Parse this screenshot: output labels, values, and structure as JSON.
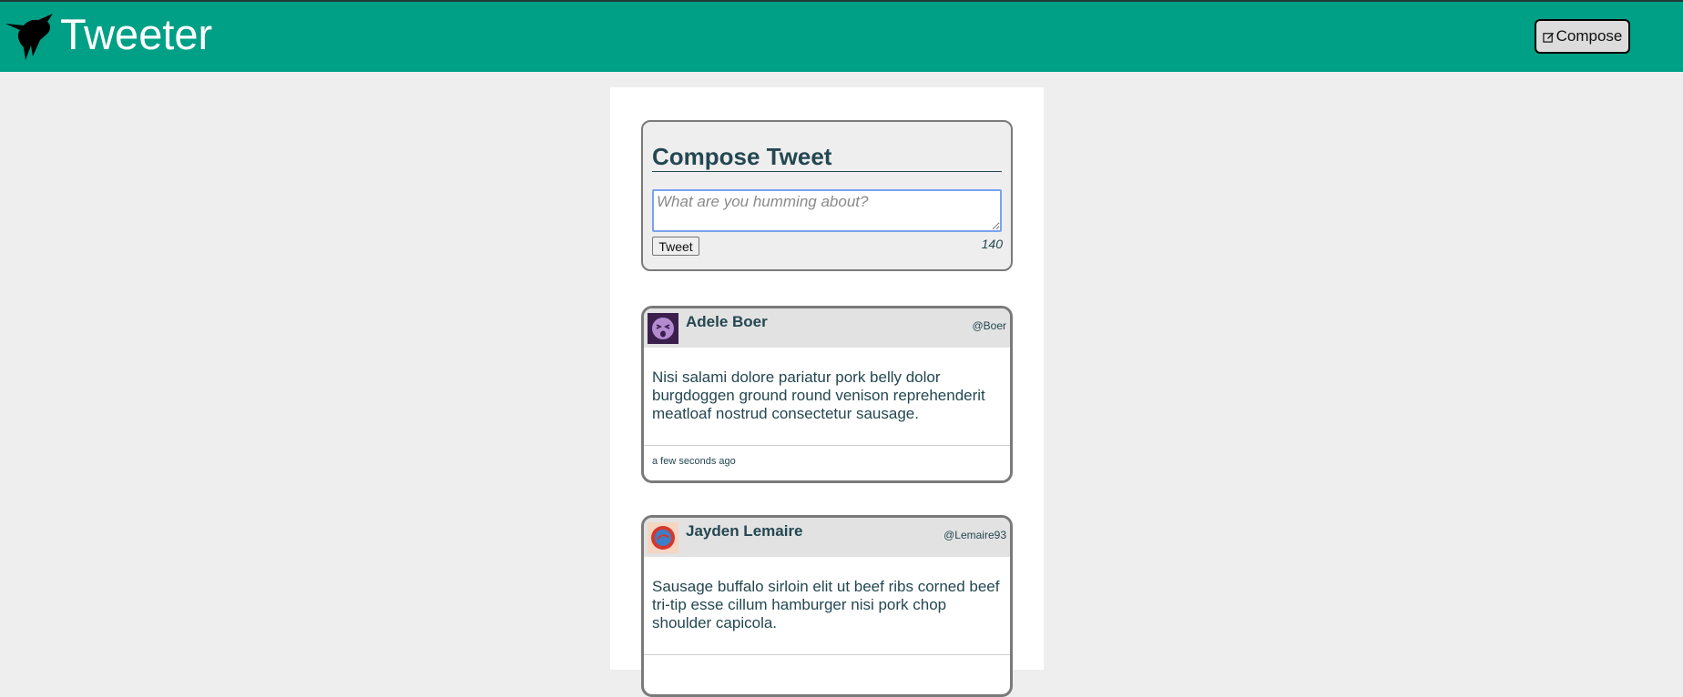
{
  "header": {
    "brand": "Tweeter",
    "compose_label": "Compose",
    "brand_color": "#00a087"
  },
  "composer": {
    "title": "Compose Tweet",
    "placeholder": "What are you humming about?",
    "submit_label": "Tweet",
    "char_count": "140"
  },
  "tweets": [
    {
      "name": "Adele Boer",
      "handle": "@Boer",
      "text": "Nisi salami dolore pariatur pork belly dolor burgdoggen ground round venison reprehenderit meatloaf nostrud consectetur sausage.",
      "time": "a few seconds ago",
      "avatar_icon": "purple-face-avatar"
    },
    {
      "name": "Jayden Lemaire",
      "handle": "@Lemaire93",
      "text": "Sausage buffalo sirloin elit ut beef ribs corned beef tri-tip esse cillum hamburger nisi pork chop shoulder capicola.",
      "time": "",
      "avatar_icon": "red-blue-avatar"
    }
  ]
}
